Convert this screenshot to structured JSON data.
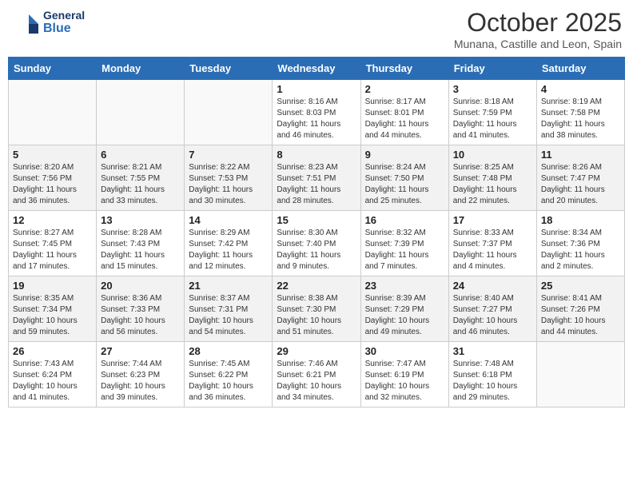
{
  "logo": {
    "general": "General",
    "blue": "Blue"
  },
  "title": "October 2025",
  "location": "Munana, Castille and Leon, Spain",
  "days_of_week": [
    "Sunday",
    "Monday",
    "Tuesday",
    "Wednesday",
    "Thursday",
    "Friday",
    "Saturday"
  ],
  "weeks": [
    [
      {
        "day": "",
        "info": ""
      },
      {
        "day": "",
        "info": ""
      },
      {
        "day": "",
        "info": ""
      },
      {
        "day": "1",
        "info": "Sunrise: 8:16 AM\nSunset: 8:03 PM\nDaylight: 11 hours and 46 minutes."
      },
      {
        "day": "2",
        "info": "Sunrise: 8:17 AM\nSunset: 8:01 PM\nDaylight: 11 hours and 44 minutes."
      },
      {
        "day": "3",
        "info": "Sunrise: 8:18 AM\nSunset: 7:59 PM\nDaylight: 11 hours and 41 minutes."
      },
      {
        "day": "4",
        "info": "Sunrise: 8:19 AM\nSunset: 7:58 PM\nDaylight: 11 hours and 38 minutes."
      }
    ],
    [
      {
        "day": "5",
        "info": "Sunrise: 8:20 AM\nSunset: 7:56 PM\nDaylight: 11 hours and 36 minutes."
      },
      {
        "day": "6",
        "info": "Sunrise: 8:21 AM\nSunset: 7:55 PM\nDaylight: 11 hours and 33 minutes."
      },
      {
        "day": "7",
        "info": "Sunrise: 8:22 AM\nSunset: 7:53 PM\nDaylight: 11 hours and 30 minutes."
      },
      {
        "day": "8",
        "info": "Sunrise: 8:23 AM\nSunset: 7:51 PM\nDaylight: 11 hours and 28 minutes."
      },
      {
        "day": "9",
        "info": "Sunrise: 8:24 AM\nSunset: 7:50 PM\nDaylight: 11 hours and 25 minutes."
      },
      {
        "day": "10",
        "info": "Sunrise: 8:25 AM\nSunset: 7:48 PM\nDaylight: 11 hours and 22 minutes."
      },
      {
        "day": "11",
        "info": "Sunrise: 8:26 AM\nSunset: 7:47 PM\nDaylight: 11 hours and 20 minutes."
      }
    ],
    [
      {
        "day": "12",
        "info": "Sunrise: 8:27 AM\nSunset: 7:45 PM\nDaylight: 11 hours and 17 minutes."
      },
      {
        "day": "13",
        "info": "Sunrise: 8:28 AM\nSunset: 7:43 PM\nDaylight: 11 hours and 15 minutes."
      },
      {
        "day": "14",
        "info": "Sunrise: 8:29 AM\nSunset: 7:42 PM\nDaylight: 11 hours and 12 minutes."
      },
      {
        "day": "15",
        "info": "Sunrise: 8:30 AM\nSunset: 7:40 PM\nDaylight: 11 hours and 9 minutes."
      },
      {
        "day": "16",
        "info": "Sunrise: 8:32 AM\nSunset: 7:39 PM\nDaylight: 11 hours and 7 minutes."
      },
      {
        "day": "17",
        "info": "Sunrise: 8:33 AM\nSunset: 7:37 PM\nDaylight: 11 hours and 4 minutes."
      },
      {
        "day": "18",
        "info": "Sunrise: 8:34 AM\nSunset: 7:36 PM\nDaylight: 11 hours and 2 minutes."
      }
    ],
    [
      {
        "day": "19",
        "info": "Sunrise: 8:35 AM\nSunset: 7:34 PM\nDaylight: 10 hours and 59 minutes."
      },
      {
        "day": "20",
        "info": "Sunrise: 8:36 AM\nSunset: 7:33 PM\nDaylight: 10 hours and 56 minutes."
      },
      {
        "day": "21",
        "info": "Sunrise: 8:37 AM\nSunset: 7:31 PM\nDaylight: 10 hours and 54 minutes."
      },
      {
        "day": "22",
        "info": "Sunrise: 8:38 AM\nSunset: 7:30 PM\nDaylight: 10 hours and 51 minutes."
      },
      {
        "day": "23",
        "info": "Sunrise: 8:39 AM\nSunset: 7:29 PM\nDaylight: 10 hours and 49 minutes."
      },
      {
        "day": "24",
        "info": "Sunrise: 8:40 AM\nSunset: 7:27 PM\nDaylight: 10 hours and 46 minutes."
      },
      {
        "day": "25",
        "info": "Sunrise: 8:41 AM\nSunset: 7:26 PM\nDaylight: 10 hours and 44 minutes."
      }
    ],
    [
      {
        "day": "26",
        "info": "Sunrise: 7:43 AM\nSunset: 6:24 PM\nDaylight: 10 hours and 41 minutes."
      },
      {
        "day": "27",
        "info": "Sunrise: 7:44 AM\nSunset: 6:23 PM\nDaylight: 10 hours and 39 minutes."
      },
      {
        "day": "28",
        "info": "Sunrise: 7:45 AM\nSunset: 6:22 PM\nDaylight: 10 hours and 36 minutes."
      },
      {
        "day": "29",
        "info": "Sunrise: 7:46 AM\nSunset: 6:21 PM\nDaylight: 10 hours and 34 minutes."
      },
      {
        "day": "30",
        "info": "Sunrise: 7:47 AM\nSunset: 6:19 PM\nDaylight: 10 hours and 32 minutes."
      },
      {
        "day": "31",
        "info": "Sunrise: 7:48 AM\nSunset: 6:18 PM\nDaylight: 10 hours and 29 minutes."
      },
      {
        "day": "",
        "info": ""
      }
    ]
  ]
}
